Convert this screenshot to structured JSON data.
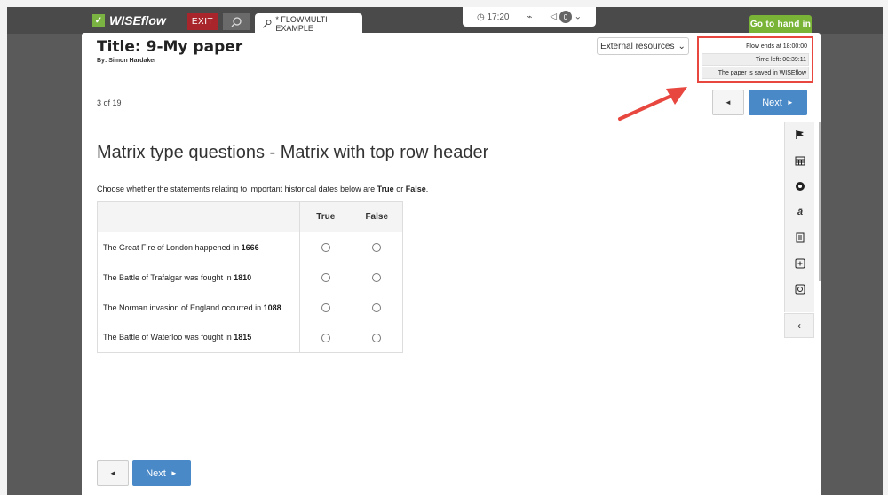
{
  "app": {
    "logo_text": "WISEflow",
    "logo_mark": "✓"
  },
  "topbar": {
    "exit_label": "EXIT",
    "flow_tab_label": "* FLOWMULTI EXAMPLE",
    "time": "17:20",
    "notification_count": "0",
    "hand_in_label": "Go to hand in"
  },
  "paper": {
    "title": "Title: 9-My paper",
    "byline": "By: Simon Hardaker",
    "external_resources_label": "External resources"
  },
  "info": {
    "flow_ends": "Flow ends at 18:00:00",
    "time_left": "Time left:  00:39:11",
    "saved_status": "The paper is saved in WISEflow"
  },
  "nav": {
    "page_count": "3 of 19",
    "prev_symbol": "◄",
    "next_label": "Next",
    "next_symbol": "►"
  },
  "question": {
    "heading": "Matrix type questions - Matrix with top row header",
    "intro_prefix": "Choose whether the statements relating to important historical dates below are ",
    "intro_true": "True",
    "intro_or": " or ",
    "intro_false": "False",
    "intro_suffix": ".",
    "columns": [
      "True",
      "False"
    ],
    "rows": [
      {
        "text": "The Great Fire of London happened in ",
        "bold": "1666"
      },
      {
        "text": "The Battle of Trafalgar was fought in ",
        "bold": "1810"
      },
      {
        "text": "The Norman invasion of England occurred in ",
        "bold": "1088"
      },
      {
        "text": "The Battle of Waterloo was fought in ",
        "bold": "1815"
      }
    ]
  },
  "sidetools": {
    "icons": [
      "flag-icon",
      "calendar-icon",
      "settings-circle-icon",
      "text-tool-icon",
      "notes-icon",
      "add-note-icon",
      "remove-note-icon"
    ],
    "collapse_symbol": "‹"
  },
  "colors": {
    "accent_green": "#79b437",
    "next_blue": "#4a89c8",
    "exit_red": "#a8262b",
    "highlight_red": "#e8473f"
  }
}
